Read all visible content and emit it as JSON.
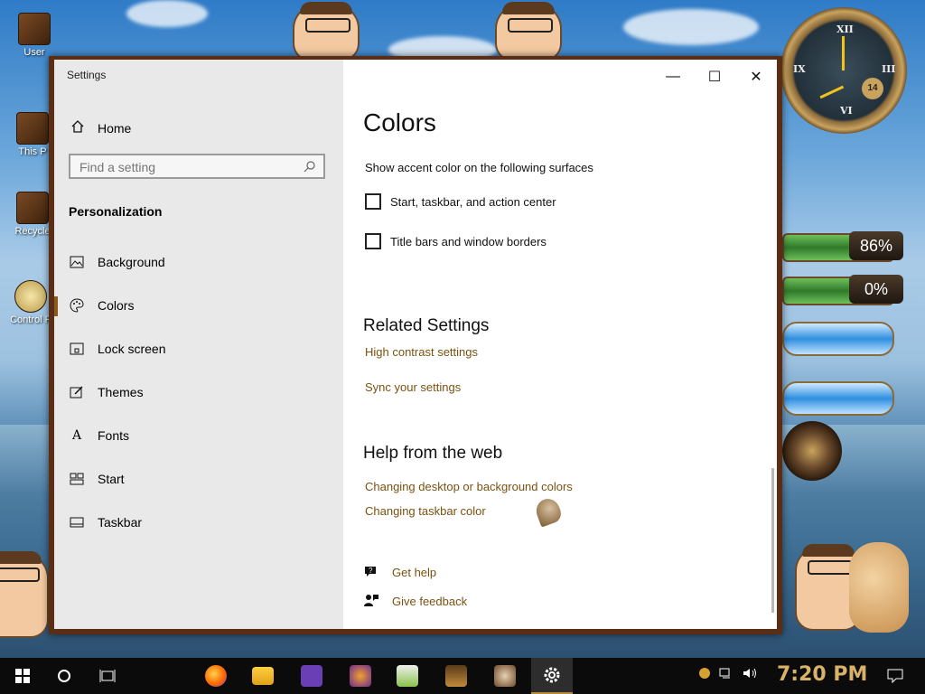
{
  "desktop": {
    "icons": [
      {
        "label": "User"
      },
      {
        "label": "This P"
      },
      {
        "label": "Recycle"
      },
      {
        "label": "Control P"
      }
    ],
    "gauges": [
      {
        "label": "86%",
        "value": 86
      },
      {
        "label": "0%",
        "value": 0
      }
    ],
    "clock_numerals": [
      "XII",
      "III",
      "VI",
      "IX"
    ],
    "clock_badge": "14"
  },
  "window": {
    "title": "Settings",
    "controls": {
      "minimize": "—",
      "maximize": "☐",
      "close": "✕"
    }
  },
  "nav": {
    "home_label": "Home",
    "search_placeholder": "Find a setting",
    "section": "Personalization",
    "items": [
      {
        "label": "Background",
        "icon": "image-icon"
      },
      {
        "label": "Colors",
        "icon": "palette-icon",
        "active": true
      },
      {
        "label": "Lock screen",
        "icon": "lock-screen-icon"
      },
      {
        "label": "Themes",
        "icon": "themes-icon"
      },
      {
        "label": "Fonts",
        "icon": "fonts-icon"
      },
      {
        "label": "Start",
        "icon": "start-icon"
      },
      {
        "label": "Taskbar",
        "icon": "taskbar-icon"
      }
    ],
    "fonts_glyph": "A"
  },
  "content": {
    "title": "Colors",
    "accent_label": "Show accent color on the following surfaces",
    "checkboxes": [
      {
        "label": "Start, taskbar, and action center",
        "checked": false
      },
      {
        "label": "Title bars and window borders",
        "checked": false
      }
    ],
    "related_heading": "Related Settings",
    "related_links": [
      "High contrast settings",
      "Sync your settings"
    ],
    "help_heading": "Help from the web",
    "help_links": [
      "Changing desktop or background colors",
      "Changing taskbar color"
    ],
    "get_help": "Get help",
    "give_feedback": "Give feedback"
  },
  "taskbar": {
    "time": "7:20 PM",
    "apps": [
      "firefox-icon",
      "file-explorer-icon",
      "visual-studio-icon",
      "game-icon",
      "notepad-icon",
      "app-icon",
      "app-icon",
      "settings-icon"
    ],
    "accent": "#d9b26a"
  }
}
